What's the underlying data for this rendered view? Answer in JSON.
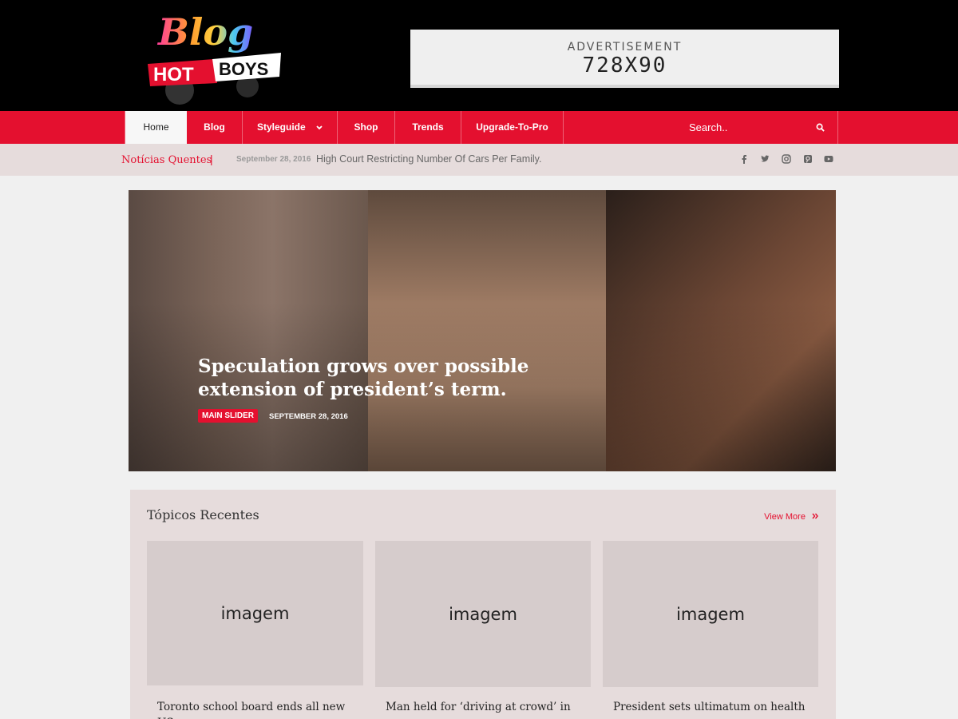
{
  "header": {
    "logo_text_top": "Blog",
    "logo_text_hot": "HOT",
    "logo_text_boys": "BOYS",
    "ad_label": "ADVERTISEMENT",
    "ad_size": "728X90"
  },
  "nav": {
    "items": [
      {
        "label": "Home"
      },
      {
        "label": "Blog"
      },
      {
        "label": "Styleguide"
      },
      {
        "label": "Shop"
      },
      {
        "label": "Trends"
      },
      {
        "label": "Upgrade-To-Pro"
      }
    ],
    "search_placeholder": "Search.."
  },
  "ticker": {
    "title": "Notícias Quentes",
    "separator": "|",
    "date": "September 28, 2016",
    "headline": "High Court Restricting Number Of Cars Per Family."
  },
  "social": [
    "facebook-icon",
    "twitter-icon",
    "instagram-icon",
    "pinterest-icon",
    "youtube-icon"
  ],
  "slider": {
    "title": "Speculation grows over possible extension of president’s term.",
    "category": "MAIN SLIDER",
    "date": "SEPTEMBER 28, 2016"
  },
  "recent": {
    "title": "Tópicos Recentes",
    "view_more": "View More",
    "cards": [
      {
        "image_placeholder": "imagem",
        "title": "Toronto school board ends all new US"
      },
      {
        "image_placeholder": "imagem",
        "title": "Man held for ‘driving at crowd’ in"
      },
      {
        "image_placeholder": "imagem",
        "title": "President sets ultimatum on health"
      }
    ]
  },
  "colors": {
    "accent": "#e4102f",
    "header_bg": "#000000",
    "ticker_bg": "#e6dcdc"
  }
}
